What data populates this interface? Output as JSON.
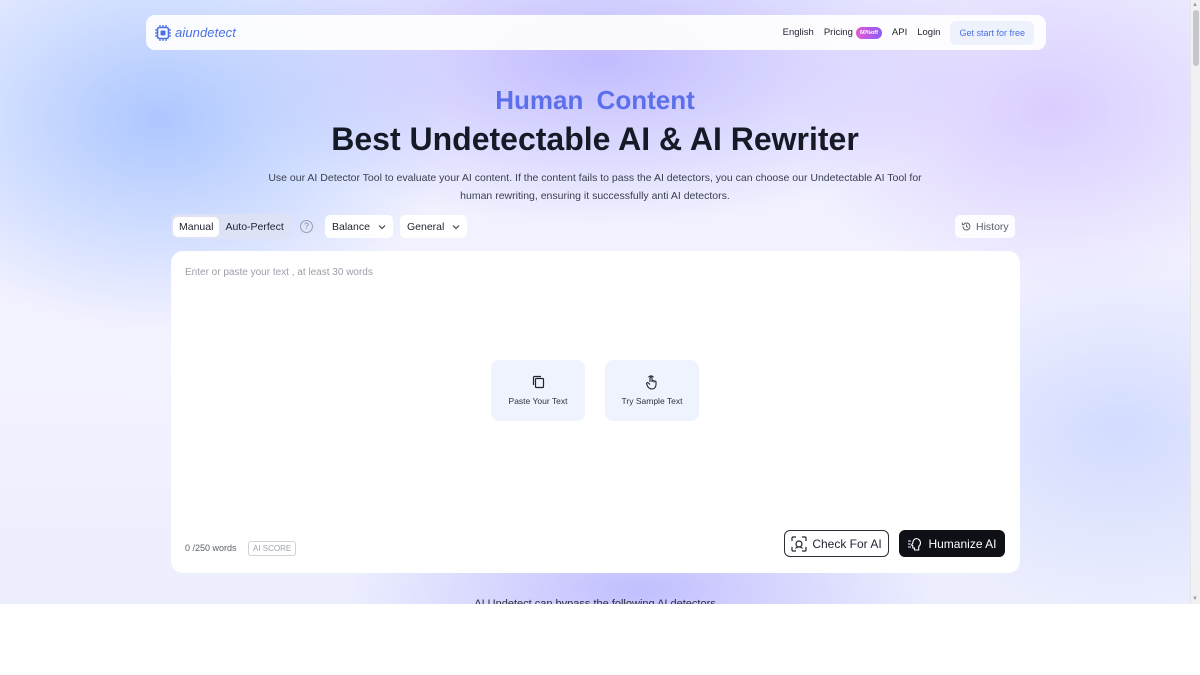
{
  "brand": {
    "name": "aiundetect",
    "color": "#4a6fe6"
  },
  "nav": {
    "language": "English",
    "pricing": "Pricing",
    "pricing_badge": "60%off",
    "api": "API",
    "login": "Login",
    "cta": "Get start for free"
  },
  "hero": {
    "subtitle": "Human  Content",
    "title": "Best Undetectable AI & AI Rewriter",
    "description": "Use our AI Detector Tool to evaluate your AI content. If the content fails to pass the AI detectors, you can choose our Undetectable AI Tool for human rewriting, ensuring it successfully anti AI detectors."
  },
  "toolbar": {
    "modes": [
      "Manual",
      "Auto-Perfect"
    ],
    "active_mode": "Manual",
    "help": "?",
    "strength": "Balance",
    "purpose": "General",
    "history": "History"
  },
  "editor": {
    "placeholder": "Enter or paste your text , at least 30 words",
    "paste_label": "Paste Your Text",
    "sample_label": "Try Sample Text",
    "word_count": "0 /250 words",
    "ai_score": "AI SCORE",
    "check_button": "Check For AI",
    "humanize_button": "Humanize AI"
  },
  "footer_peek": "AI Undetect can bypass the following AI detectors"
}
